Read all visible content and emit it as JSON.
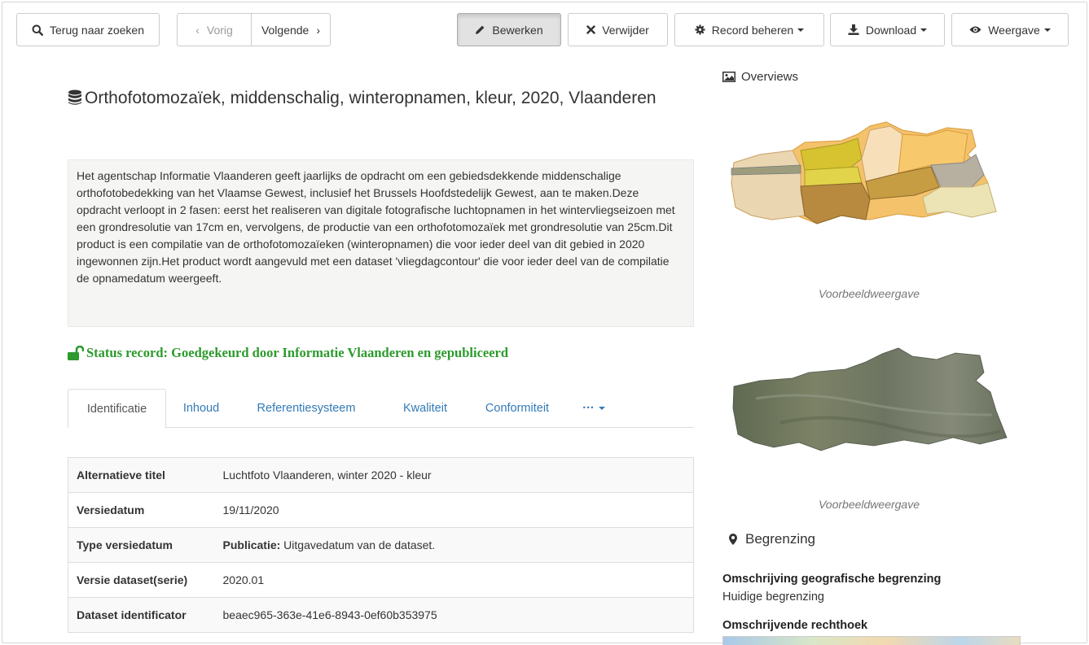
{
  "toolbar": {
    "back_label": "Terug naar zoeken",
    "prev_label": "Vorig",
    "next_label": "Volgende",
    "edit_label": "Bewerken",
    "delete_label": "Verwijder",
    "manage_label": "Record beheren",
    "download_label": "Download",
    "view_label": "Weergave"
  },
  "record": {
    "title": "Orthofotomozaïek, middenschalig, winteropnamen, kleur, 2020, Vlaanderen",
    "abstract": "Het agentschap Informatie Vlaanderen geeft jaarlijks de opdracht om een gebiedsdekkende middenschalige orthofotobedekking van het Vlaamse Gewest, inclusief het Brussels Hoofdstedelijk Gewest, aan te maken.Deze opdracht verloopt in 2 fasen: eerst het realiseren van digitale fotografische luchtopnamen in het wintervliegseizoen met een grondresolutie van 17cm en, vervolgens, de productie van een orthofotomozaïek met grondresolutie van 25cm.Dit product is een compilatie van de orthofotomozaïeken (winteropnamen) die voor ieder deel van dit gebied in 2020 ingewonnen zijn.Het product wordt aangevuld met een dataset 'vliegdagcontour' die voor ieder deel van de compilatie de opnamedatum weergeeft.",
    "status": "Status record: Goedgekeurd door Informatie Vlaanderen en gepubliceerd"
  },
  "tabs": [
    {
      "label": "Identificatie"
    },
    {
      "label": "Inhoud"
    },
    {
      "label": "Referentiesysteem"
    },
    {
      "label": "Kwaliteit"
    },
    {
      "label": "Conformiteit"
    },
    {
      "label": "···"
    }
  ],
  "details": {
    "rows": [
      {
        "key": "Alternatieve titel",
        "value": "Luchtfoto Vlaanderen, winter 2020 - kleur"
      },
      {
        "key": "Versiedatum",
        "value": "19/11/2020"
      },
      {
        "key": "Type versiedatum",
        "value_bold": "Publicatie:",
        "value": " Uitgavedatum van de dataset."
      },
      {
        "key": "Versie dataset(serie)",
        "value": "2020.01"
      },
      {
        "key": "Dataset identificator",
        "value": "beaec965-363e-41e6-8943-0ef60b353975"
      }
    ]
  },
  "sidebar": {
    "overviews_title": "Overviews",
    "caption_1": "Voorbeeldweergave",
    "caption_2": "Voorbeeldweergave",
    "extent_title": "Begrenzing",
    "geo_desc_label": "Omschrijving geografische begrenzing",
    "geo_desc_value": "Huidige begrenzing",
    "bbox_label": "Omschrijvende rechthoek"
  },
  "colors": {
    "link": "#337ab7",
    "status_green": "#2c9a2c",
    "abstract_bg": "#f5f6f4"
  }
}
